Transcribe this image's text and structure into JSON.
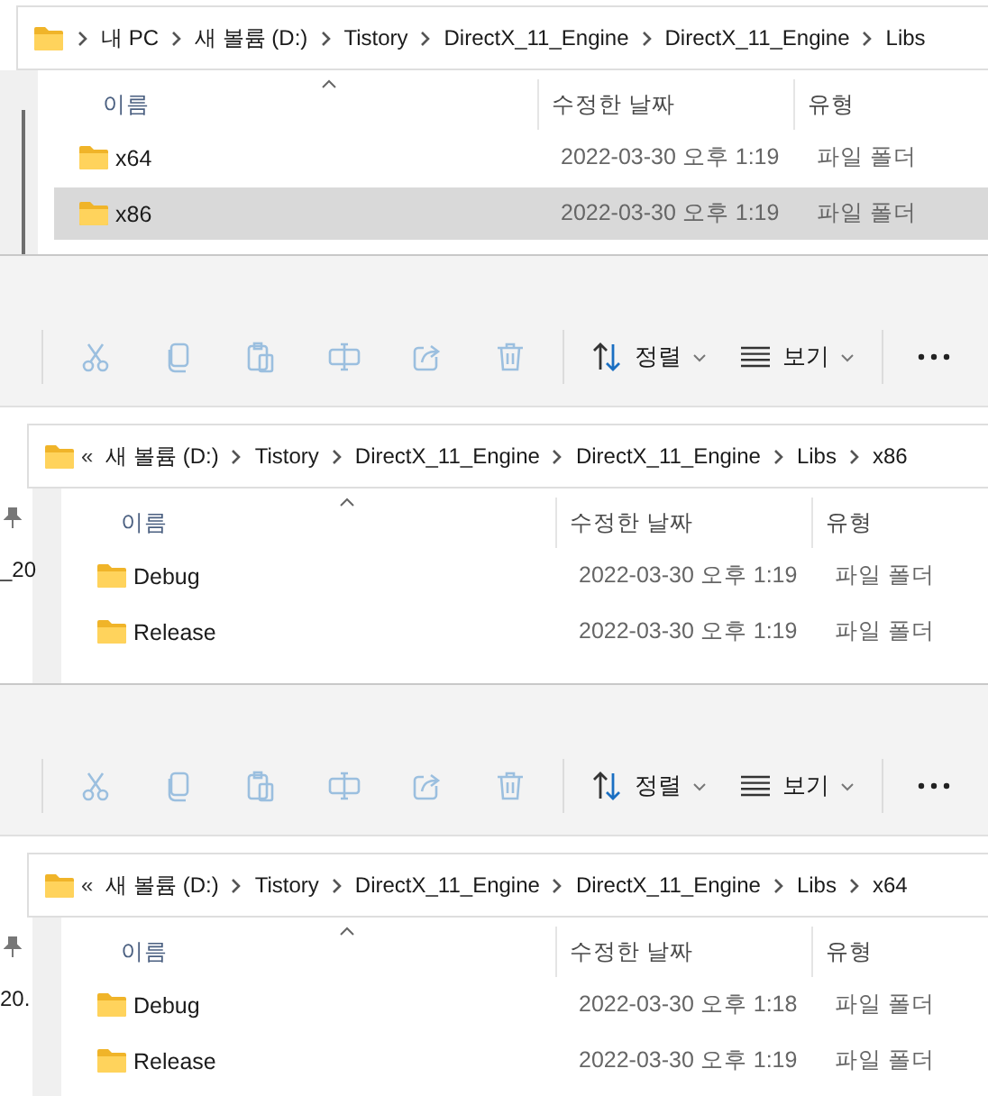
{
  "panels": [
    {
      "address": {
        "crumbs": [
          "내 PC",
          "새 볼륨 (D:)",
          "Tistory",
          "DirectX_11_Engine",
          "DirectX_11_Engine",
          "Libs"
        ]
      },
      "columns": [
        "이름",
        "수정한 날짜",
        "유형"
      ],
      "rows": [
        {
          "name": "x64",
          "date": "2022-03-30 오후 1:19",
          "type": "파일 폴더",
          "selected": false
        },
        {
          "name": "x86",
          "date": "2022-03-30 오후 1:19",
          "type": "파일 폴더",
          "selected": true
        }
      ]
    },
    {
      "toolbar": {
        "actions": [
          {
            "kind": "cut",
            "disabled": true
          },
          {
            "kind": "copy",
            "disabled": true
          },
          {
            "kind": "paste",
            "disabled": true
          },
          {
            "kind": "rename",
            "disabled": true
          },
          {
            "kind": "share",
            "disabled": true
          },
          {
            "kind": "delete",
            "disabled": true
          }
        ],
        "sort": "정렬",
        "view": "보기"
      },
      "sidebar": {
        "pinned": true,
        "label": "_20"
      },
      "address": {
        "overflow": "«",
        "crumbs": [
          "새 볼륨 (D:)",
          "Tistory",
          "DirectX_11_Engine",
          "DirectX_11_Engine",
          "Libs",
          "x86"
        ]
      },
      "columns": [
        "이름",
        "수정한 날짜",
        "유형"
      ],
      "rows": [
        {
          "name": "Debug",
          "date": "2022-03-30 오후 1:19",
          "type": "파일 폴더",
          "selected": false
        },
        {
          "name": "Release",
          "date": "2022-03-30 오후 1:19",
          "type": "파일 폴더",
          "selected": false
        }
      ]
    },
    {
      "toolbar": {
        "actions": [
          {
            "kind": "cut",
            "disabled": true
          },
          {
            "kind": "copy",
            "disabled": true
          },
          {
            "kind": "paste",
            "disabled": true
          },
          {
            "kind": "rename",
            "disabled": true
          },
          {
            "kind": "share",
            "disabled": true
          },
          {
            "kind": "delete",
            "disabled": true
          }
        ],
        "sort": "정렬",
        "view": "보기"
      },
      "sidebar": {
        "pinned": true,
        "label": "20."
      },
      "address": {
        "overflow": "«",
        "crumbs": [
          "새 볼륨 (D:)",
          "Tistory",
          "DirectX_11_Engine",
          "DirectX_11_Engine",
          "Libs",
          "x64"
        ]
      },
      "columns": [
        "이름",
        "수정한 날짜",
        "유형"
      ],
      "rows": [
        {
          "name": "Debug",
          "date": "2022-03-30 오후 1:18",
          "type": "파일 폴더",
          "selected": false
        },
        {
          "name": "Release",
          "date": "2022-03-30 오후 1:19",
          "type": "파일 폴더",
          "selected": false
        }
      ]
    }
  ]
}
